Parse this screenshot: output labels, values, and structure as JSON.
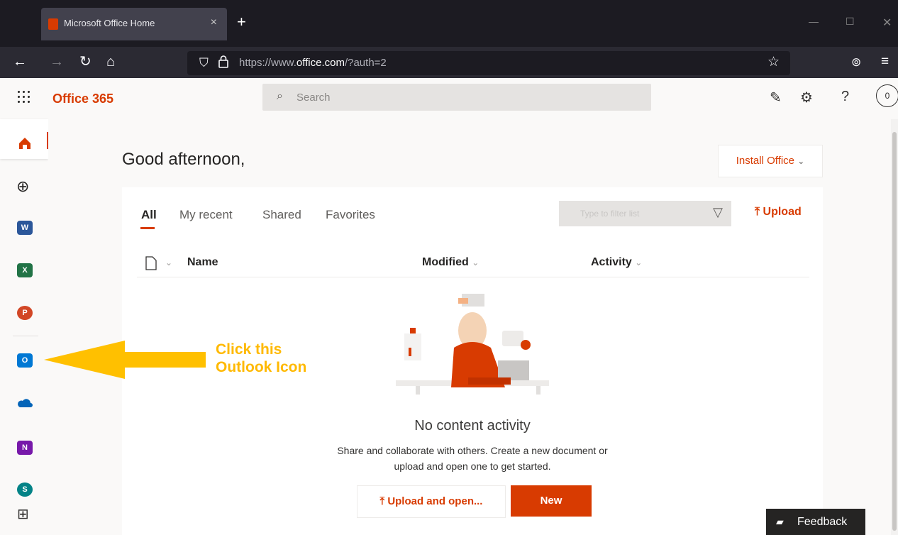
{
  "browser": {
    "tab_title": "Microsoft Office Home",
    "url_prefix": "https://www.",
    "url_domain": "office.com",
    "url_suffix": "/?auth=2"
  },
  "header": {
    "brand": "Office 365",
    "search_placeholder": "Search",
    "avatar_initial": "0"
  },
  "main": {
    "greeting": "Good afternoon,",
    "install_label": "Install Office",
    "tabs": [
      "All",
      "My recent",
      "Shared",
      "Favorites"
    ],
    "filter_placeholder": "Type to filter list",
    "upload_label": "Upload",
    "columns": [
      "Name",
      "Modified",
      "Activity"
    ],
    "empty_title": "No content activity",
    "empty_line1": "Share and collaborate with others. Create a new document or",
    "empty_line2": "upload and open one to get started.",
    "upload_open_label": "Upload and open...",
    "new_label": "New"
  },
  "annotation": {
    "line1": "Click this",
    "line2": "Outlook Icon"
  },
  "feedback_label": "Feedback",
  "rail_apps": [
    "home-icon",
    "create-icon",
    "word-icon",
    "excel-icon",
    "powerpoint-icon",
    "outlook-icon",
    "onedrive-icon",
    "onenote-icon",
    "sharepoint-icon",
    "all-apps-icon"
  ],
  "colors": {
    "accent": "#d83b01",
    "callout": "#ffb900"
  }
}
